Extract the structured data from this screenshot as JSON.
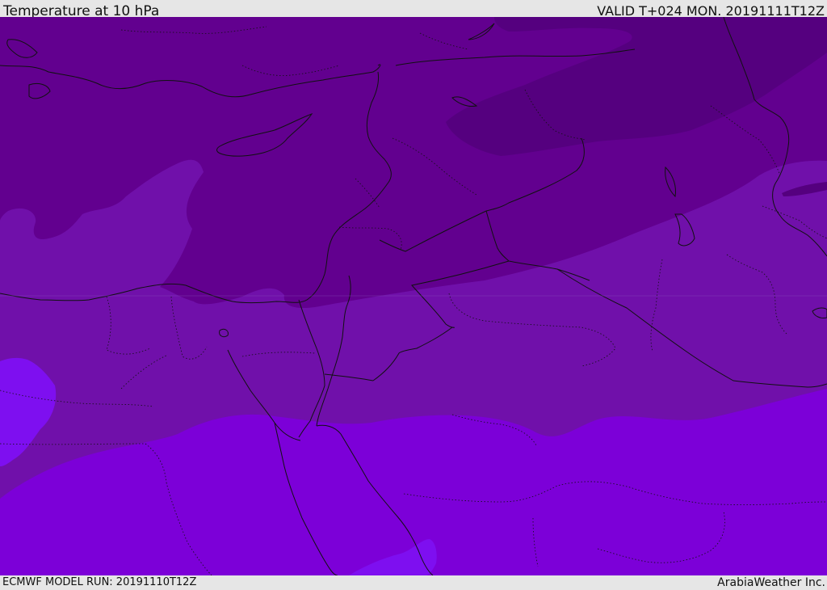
{
  "header": {
    "title": "Temperature at 10 hPa",
    "valid": "VALID T+024 MON. 20191111T12Z"
  },
  "footer": {
    "model_run": "ECMWF MODEL RUN: 20191110T12Z",
    "credit": "ArabiaWeather Inc."
  },
  "map": {
    "region": "Eastern Mediterranean and Middle East",
    "colors": {
      "coldest_band": "#55007f",
      "cold_band": "#62008f",
      "mid_band": "#7010aa",
      "warm_band": "#7c00d8",
      "warmest_band": "#7e0ff0",
      "coastline": "#111111",
      "border": "#111111"
    }
  }
}
